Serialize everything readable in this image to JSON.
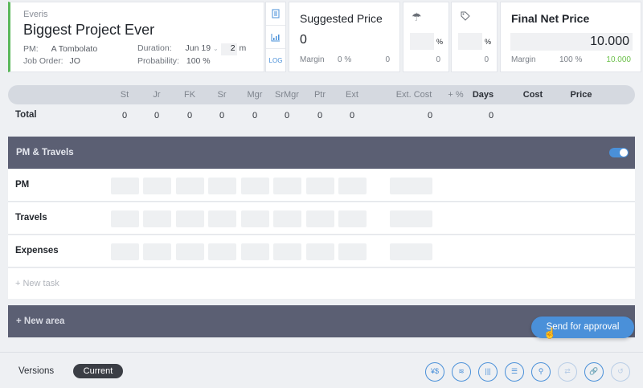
{
  "project": {
    "company": "Everis",
    "title": "Biggest Project Ever",
    "pm_label": "PM:",
    "pm_value": "A Tombolato",
    "job_order_label": "Job Order:",
    "job_order_value": "JO",
    "duration_label": "Duration:",
    "duration_month": "Jun 19",
    "duration_value": "2",
    "duration_unit": "m",
    "probability_label": "Probability:",
    "probability_value": "100 %"
  },
  "tools": {
    "log_label": "LOG"
  },
  "suggested": {
    "title": "Suggested Price",
    "value": "0",
    "margin_label": "Margin",
    "margin_pct": "0 %",
    "margin_value": "0"
  },
  "pct_cards": [
    {
      "icon": "umbrella-icon",
      "sign": "%",
      "zero": "0"
    },
    {
      "icon": "tag-icon",
      "sign": "%",
      "zero": "0"
    }
  ],
  "final": {
    "title": "Final Net Price",
    "value": "10.000",
    "margin_label": "Margin",
    "margin_pct": "100 %",
    "margin_value": "10.000",
    "accent": "#6cc04a"
  },
  "columns": [
    "St",
    "Jr",
    "FK",
    "Sr",
    "Mgr",
    "SrMgr",
    "Ptr",
    "Ext",
    "Ext. Cost",
    "+ %",
    "Days",
    "Cost",
    "Price"
  ],
  "total": {
    "label": "Total",
    "values": [
      "0",
      "0",
      "0",
      "0",
      "0",
      "0",
      "0",
      "0"
    ],
    "ext_cost": "0",
    "days": "0"
  },
  "area": {
    "name": "PM & Travels"
  },
  "tasks": [
    "PM",
    "Travels",
    "Expenses"
  ],
  "new_task_label": "+ New task",
  "new_area_label": "+ New area",
  "send_button_label": "Send for approval",
  "bottom": {
    "versions_label": "Versions",
    "current_label": "Current",
    "buttons": [
      "¥$",
      "≋",
      "|||",
      "☰",
      "⚲",
      "⇄",
      "🔗",
      "↺"
    ]
  },
  "colors": {
    "primary": "#4a90d9",
    "area_bar": "#5b5f73",
    "project_accent": "#5cb85c"
  }
}
